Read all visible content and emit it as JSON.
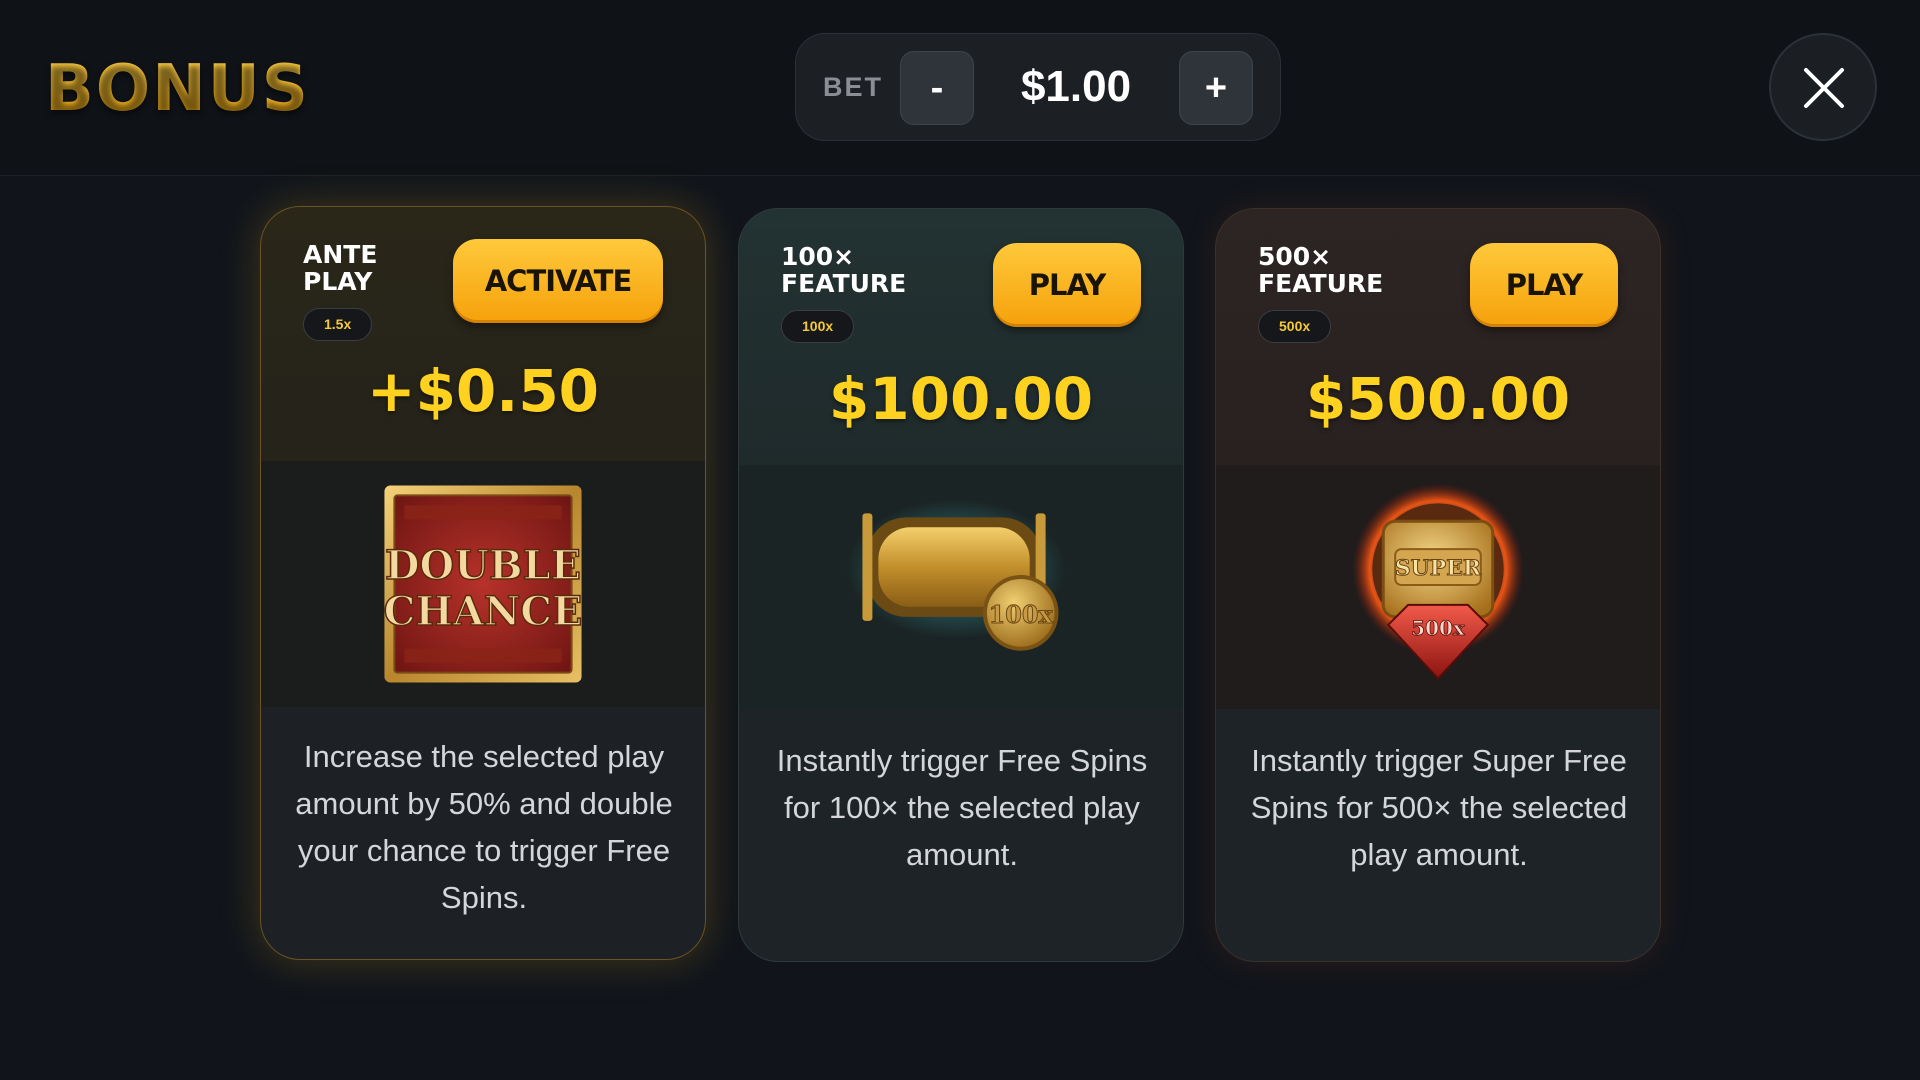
{
  "header": {
    "title": "BONUS",
    "bet_label": "BET",
    "bet_minus": "-",
    "bet_value": "$1.00",
    "bet_plus": "+"
  },
  "cards": [
    {
      "title_line1": "ANTE",
      "title_line2": "PLAY",
      "badge": "1.5x",
      "button_label": "ACTIVATE",
      "amount": "+$0.50",
      "image_text_line1": "DOUBLE",
      "image_text_line2": "CHANCE",
      "description": "Increase the selected play amount by 50% and double your chance to trigger Free Spins."
    },
    {
      "title_line1": "100×",
      "title_line2": "FEATURE",
      "badge": "100x",
      "button_label": "PLAY",
      "amount": "$100.00",
      "image_text": "100x",
      "description": "Instantly trigger Free Spins for 100× the selected play amount."
    },
    {
      "title_line1": "500×",
      "title_line2": "FEATURE",
      "badge": "500x",
      "button_label": "PLAY",
      "amount": "$500.00",
      "image_text_line1": "SUPER",
      "image_text_line2": "500x",
      "description": "Instantly trigger Super Free Spins for 500× the selected play amount."
    }
  ],
  "colors": {
    "accent_gold": "#ffd21f",
    "button_orange": "#f5a10a",
    "background": "#11151b"
  },
  "icons": {
    "close": "close-icon"
  }
}
